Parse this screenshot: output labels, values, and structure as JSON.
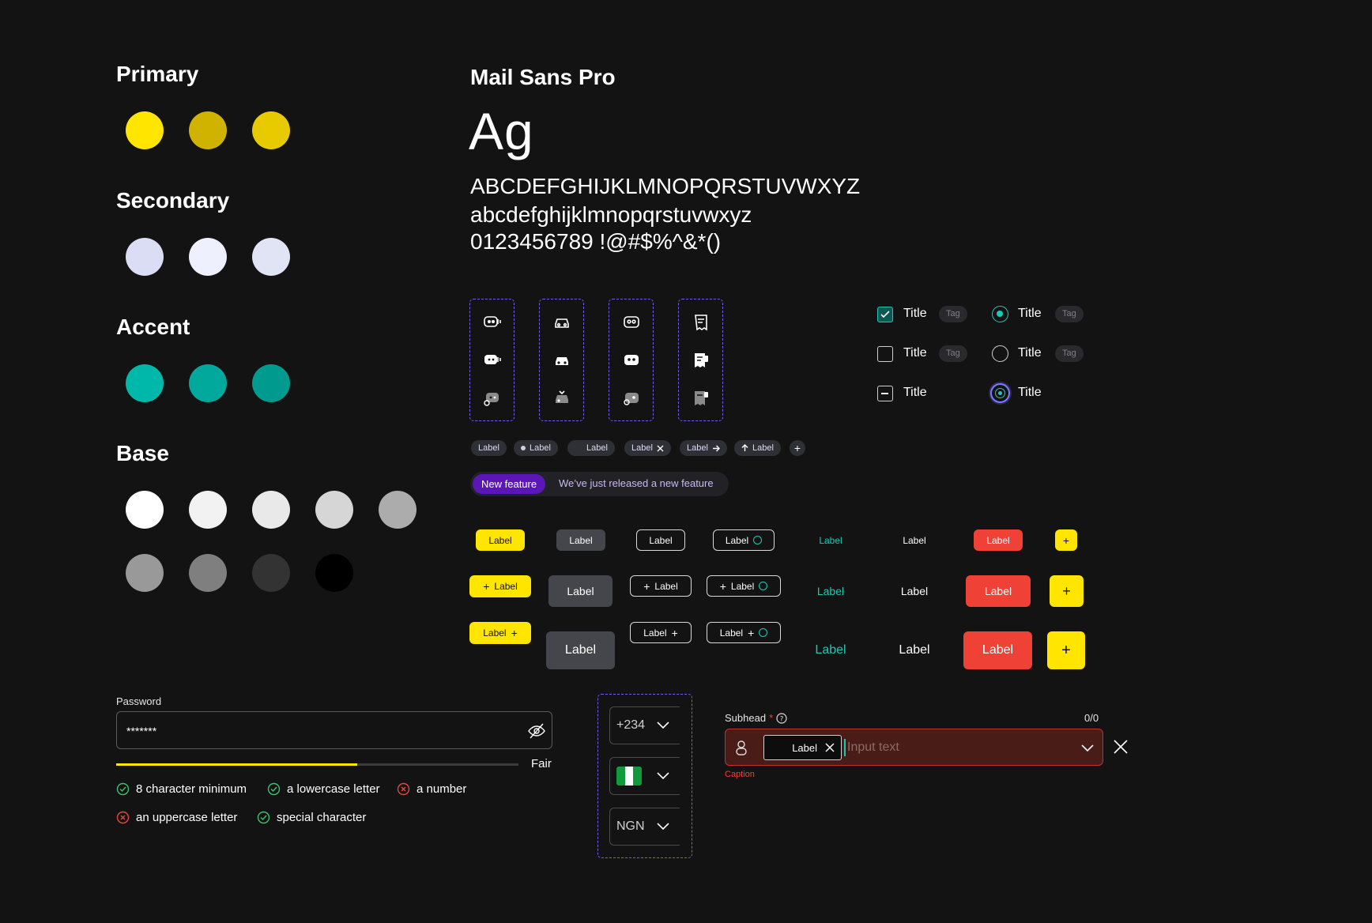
{
  "palette": {
    "primary": {
      "title": "Primary",
      "colors": [
        "#FFE500",
        "#CFB300",
        "#E8CA00"
      ]
    },
    "secondary": {
      "title": "Secondary",
      "colors": [
        "#DADDF3",
        "#EEF0FE",
        "#E1E4F4"
      ]
    },
    "accent": {
      "title": "Accent",
      "colors": [
        "#00B8AA",
        "#00A99C",
        "#009A8F"
      ]
    },
    "base": {
      "title": "Base",
      "colors": [
        "#FFFFFF",
        "#F2F2F2",
        "#E9E9E9",
        "#D6D6D6",
        "#ACACAC",
        "#999999",
        "#7F7F7F",
        "#333333",
        "#000000"
      ]
    }
  },
  "typography": {
    "font_name": "Mail Sans Pro",
    "sample": "Ag",
    "uppercase": "ABCDEFGHIJKLMNOPQRSTUVWXYZ",
    "lowercase": "abcdefghijklmnopqrstuvwxyz",
    "numbers": "0123456789 !@#$%^&*()"
  },
  "icon_sets": [
    "chat-bot",
    "car",
    "bot-face",
    "receipt"
  ],
  "chips": {
    "c1": "Label",
    "c2": "Label",
    "c3": "Label",
    "c4": "Label",
    "c5": "Label",
    "c6": "Label",
    "add": "+"
  },
  "announcement": {
    "badge": "New feature",
    "text": "We’ve just released a new feature"
  },
  "buttons": {
    "label": "Label",
    "plus": "+"
  },
  "controls": {
    "checkbox_title": "Title",
    "radio_title": "Title",
    "tag": "Tag"
  },
  "password": {
    "label": "Password",
    "value": "*******",
    "strength_label": "Fair",
    "strength_value": 0.6,
    "requirements": [
      {
        "text": "8 character minimum",
        "ok": true
      },
      {
        "text": "a lowercase letter",
        "ok": true
      },
      {
        "text": "a number",
        "ok": false
      },
      {
        "text": "an uppercase letter",
        "ok": false
      },
      {
        "text": "special character",
        "ok": true
      }
    ]
  },
  "selectors": {
    "phone_code": "+234",
    "currency": "NGN"
  },
  "input_field": {
    "subhead": "Subhead",
    "required_mark": "*",
    "counter": "0/0",
    "chip": "Label",
    "placeholder": "Input text",
    "caption": "Caption"
  },
  "colors": {
    "yellow": "#FFE500",
    "teal": "#1EC8B8",
    "red": "#EF4136",
    "purple": "#5B16B8",
    "dashed_border": "#7B5CF0"
  }
}
